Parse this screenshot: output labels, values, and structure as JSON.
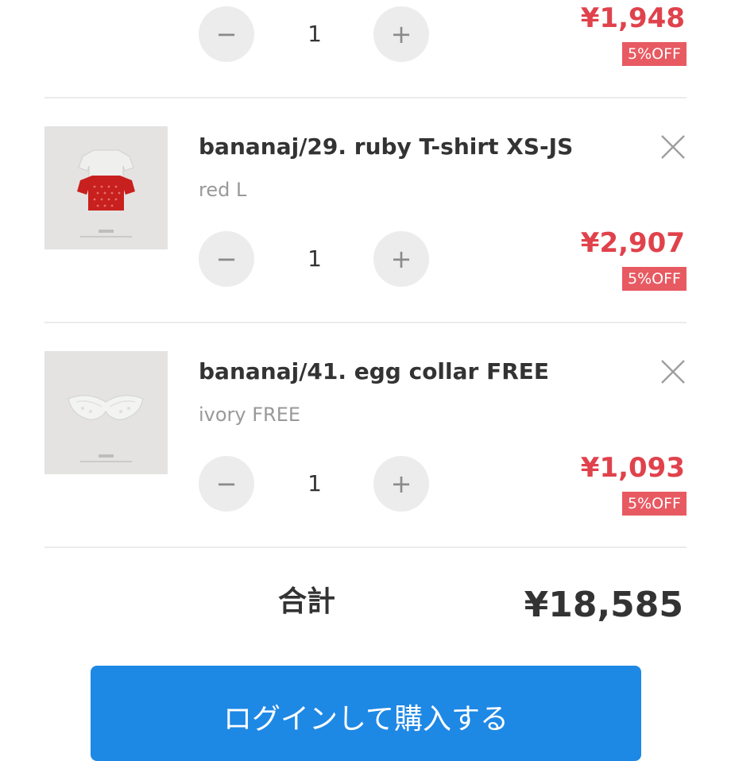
{
  "colors": {
    "price": "#e0424c",
    "badge": "#e85a62",
    "button": "#1e88e5"
  },
  "top_item": {
    "quantity": "1",
    "price": "¥1,948",
    "discount": "5%OFF"
  },
  "items": [
    {
      "title": "bananaj/29. ruby T-shirt XS-JS",
      "variant": "red L",
      "quantity": "1",
      "price": "¥2,907",
      "discount": "5%OFF",
      "image": "red-knit-t-shirt-photo"
    },
    {
      "title": "bananaj/41. egg collar FREE",
      "variant": "ivory FREE",
      "quantity": "1",
      "price": "¥1,093",
      "discount": "5%OFF",
      "image": "ivory-lace-collar-photo"
    }
  ],
  "controls": {
    "minus": "−",
    "plus": "+"
  },
  "summary": {
    "total_label": "合計",
    "total_value": "¥18,585"
  },
  "checkout": {
    "label": "ログインして購入する"
  }
}
